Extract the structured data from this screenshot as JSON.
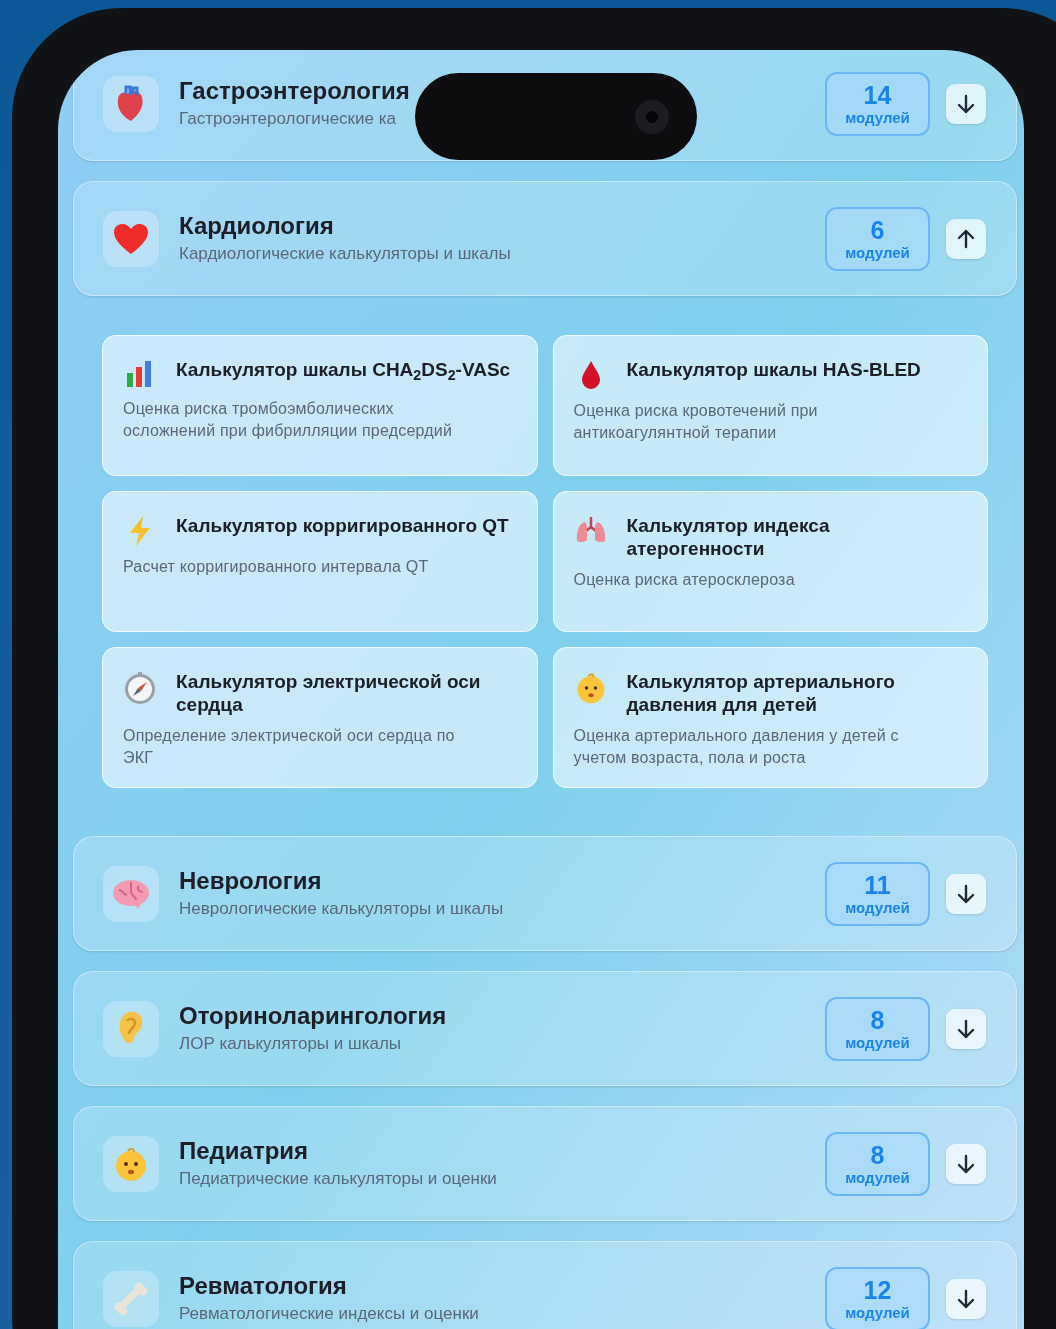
{
  "categories": [
    {
      "title": "Гастроэнтерология",
      "subtitle": "Гастроэнтерологические ка",
      "count": "14",
      "count_label": "модулей",
      "expanded": false
    },
    {
      "title": "Кардиология",
      "subtitle": "Кардиологические калькуляторы и шкалы",
      "count": "6",
      "count_label": "модулей",
      "expanded": true,
      "modules": [
        {
          "title": "Калькулятор шкалы CHA$_{2}$DS$_{2}$-VASc",
          "description": "Оценка риска тромбоэмболических осложнений при фибрилляции предсердий"
        },
        {
          "title": "Калькулятор шкалы HAS-BLED",
          "description": "Оценка риска кровотечений при антикоагулянтной терапии"
        },
        {
          "title": "Калькулятор корригированного QT",
          "description": "Расчет корригированного интервала QT"
        },
        {
          "title": "Калькулятор индекса атерогенности",
          "description": "Оценка риска атеросклероза"
        },
        {
          "title": "Калькулятор электрической оси сердца",
          "description": "Определение электрической оси сердца по ЭКГ"
        },
        {
          "title": "Калькулятор артериального давления для детей",
          "description": "Оценка артериального давления у детей с учетом возраста, пола и роста"
        }
      ]
    },
    {
      "title": "Неврология",
      "subtitle": "Неврологические калькуляторы и шкалы",
      "count": "11",
      "count_label": "модулей",
      "expanded": false
    },
    {
      "title": "Оториноларингология",
      "subtitle": "ЛОР калькуляторы и шкалы",
      "count": "8",
      "count_label": "модулей",
      "expanded": false
    },
    {
      "title": "Педиатрия",
      "subtitle": "Педиатрические калькуляторы и оценки",
      "count": "8",
      "count_label": "модулей",
      "expanded": false
    },
    {
      "title": "Ревматология",
      "subtitle": "Ревматологические индексы и оценки",
      "count": "12",
      "count_label": "модулей",
      "expanded": false
    }
  ]
}
